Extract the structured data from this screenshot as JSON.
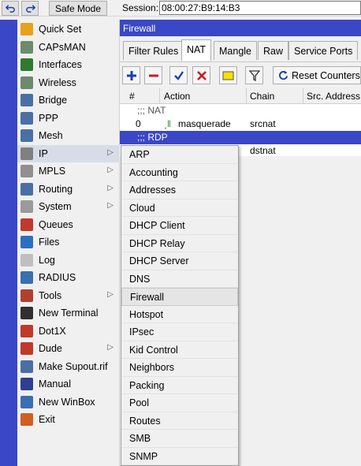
{
  "toolbar": {
    "safe_mode_label": "Safe Mode",
    "session_label": "Session:",
    "session_value": "08:00:27:B9:14:B3"
  },
  "sidemenu": {
    "items": [
      {
        "label": "Quick Set",
        "icon": "quick-set-icon",
        "color": "#e7a11c"
      },
      {
        "label": "CAPsMAN",
        "icon": "capsman-icon",
        "color": "#6c8a6c"
      },
      {
        "label": "Interfaces",
        "icon": "interfaces-icon",
        "color": "#2f7a2f"
      },
      {
        "label": "Wireless",
        "icon": "wireless-icon",
        "color": "#6c8a6c"
      },
      {
        "label": "Bridge",
        "icon": "bridge-icon",
        "color": "#4a6fa5"
      },
      {
        "label": "PPP",
        "icon": "ppp-icon",
        "color": "#4a6fa5"
      },
      {
        "label": "Mesh",
        "icon": "mesh-icon",
        "color": "#4a6fa5"
      },
      {
        "label": "IP",
        "icon": "ip-icon",
        "color": "#808080",
        "arrow": true
      },
      {
        "label": "MPLS",
        "icon": "mpls-icon",
        "color": "#909090",
        "arrow": true
      },
      {
        "label": "Routing",
        "icon": "routing-icon",
        "color": "#4a6fa5",
        "arrow": true
      },
      {
        "label": "System",
        "icon": "system-icon",
        "color": "#9a9a9a",
        "arrow": true
      },
      {
        "label": "Queues",
        "icon": "queues-icon",
        "color": "#c0392b"
      },
      {
        "label": "Files",
        "icon": "files-icon",
        "color": "#2f6fc0"
      },
      {
        "label": "Log",
        "icon": "log-icon",
        "color": "#bfbfbf"
      },
      {
        "label": "RADIUS",
        "icon": "radius-icon",
        "color": "#3a6fb0"
      },
      {
        "label": "Tools",
        "icon": "tools-icon",
        "color": "#b04030",
        "arrow": true
      },
      {
        "label": "New Terminal",
        "icon": "terminal-icon",
        "color": "#303030"
      },
      {
        "label": "Dot1X",
        "icon": "dot1x-icon",
        "color": "#c0392b"
      },
      {
        "label": "Dude",
        "icon": "dude-icon",
        "color": "#c0392b",
        "arrow": true
      },
      {
        "label": "Make Supout.rif",
        "icon": "supout-icon",
        "color": "#4a6fa5"
      },
      {
        "label": "Manual",
        "icon": "manual-icon",
        "color": "#2f3f8f"
      },
      {
        "label": "New WinBox",
        "icon": "winbox-icon",
        "color": "#3a6fb0"
      },
      {
        "label": "Exit",
        "icon": "exit-icon",
        "color": "#d06020"
      }
    ]
  },
  "firewall": {
    "title": "Firewall",
    "tabs": [
      "Filter Rules",
      "NAT",
      "Mangle",
      "Raw",
      "Service Ports"
    ],
    "selected_tab": "NAT",
    "reset_label": "Reset Counters",
    "columns": [
      "#",
      "Action",
      "Chain",
      "Src. Address"
    ],
    "rows": [
      {
        "type": "group",
        "text": ";;; NAT"
      },
      {
        "type": "rule",
        "num": "0",
        "action": "masquerade",
        "chain": "srcnat"
      },
      {
        "type": "group",
        "text": ";;; RDP",
        "selected": true
      },
      {
        "type": "rule",
        "num": "",
        "action": "",
        "chain": "dstnat"
      }
    ]
  },
  "ip_submenu": {
    "items": [
      "ARP",
      "Accounting",
      "Addresses",
      "Cloud",
      "DHCP Client",
      "DHCP Relay",
      "DHCP Server",
      "DNS",
      "Firewall",
      "Hotspot",
      "IPsec",
      "Kid Control",
      "Neighbors",
      "Packing",
      "Pool",
      "Routes",
      "SMB",
      "SNMP"
    ],
    "highlighted": "Firewall"
  }
}
